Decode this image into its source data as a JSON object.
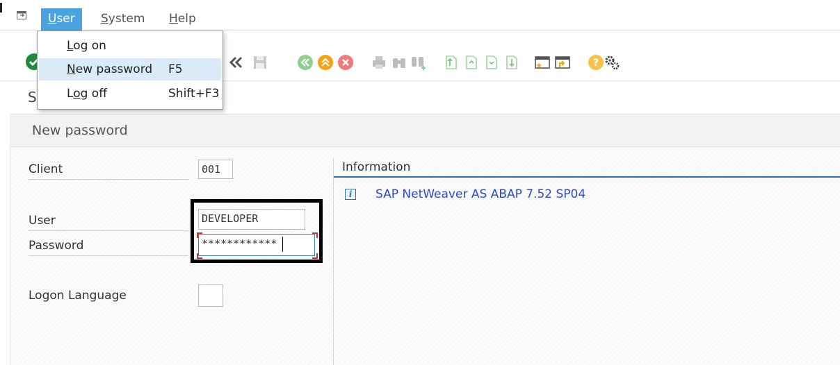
{
  "menu": {
    "items": [
      {
        "label": "User",
        "mnemonic": "U",
        "rest": "ser",
        "active": true
      },
      {
        "label": "System",
        "mnemonic": "S",
        "rest": "ystem"
      },
      {
        "label": "Help",
        "mnemonic": "H",
        "rest": "elp"
      }
    ]
  },
  "dropdown": {
    "items": [
      {
        "label_pre": "",
        "mnemonic": "L",
        "label_post": "og on",
        "shortcut": ""
      },
      {
        "label_pre": "",
        "mnemonic": "N",
        "label_post": "ew password",
        "shortcut": "F5",
        "highlighted": true
      },
      {
        "label_pre": "L",
        "mnemonic": "o",
        "label_post": "g off",
        "shortcut": "Shift+F3"
      }
    ]
  },
  "title": {
    "text": "S"
  },
  "subtitle": {
    "text": "New password"
  },
  "form": {
    "client": {
      "label": "Client",
      "value": "001"
    },
    "user": {
      "label": "User",
      "value": "DEVELOPER"
    },
    "password": {
      "label": "Password",
      "value": "************"
    },
    "language": {
      "label": "Logon Language",
      "value": ""
    }
  },
  "info": {
    "header": "Information",
    "message": "SAP NetWeaver AS ABAP 7.52 SP04"
  },
  "colors": {
    "menu_active": "#4aa3df",
    "info_link": "#2a4ad6",
    "info_underline": "#2f6fb5",
    "highlight_frame": "#000000"
  },
  "toolbar_icons": [
    "enter-check-icon",
    "back-icon",
    "save-icon",
    "back-green-icon",
    "exit-orange-icon",
    "cancel-red-icon",
    "print-icon",
    "find-icon",
    "find-next-icon",
    "first-page-icon",
    "previous-page-icon",
    "next-page-icon",
    "last-page-icon",
    "new-session-icon",
    "shortcut-icon",
    "help-icon",
    "customize-layout-icon"
  ]
}
